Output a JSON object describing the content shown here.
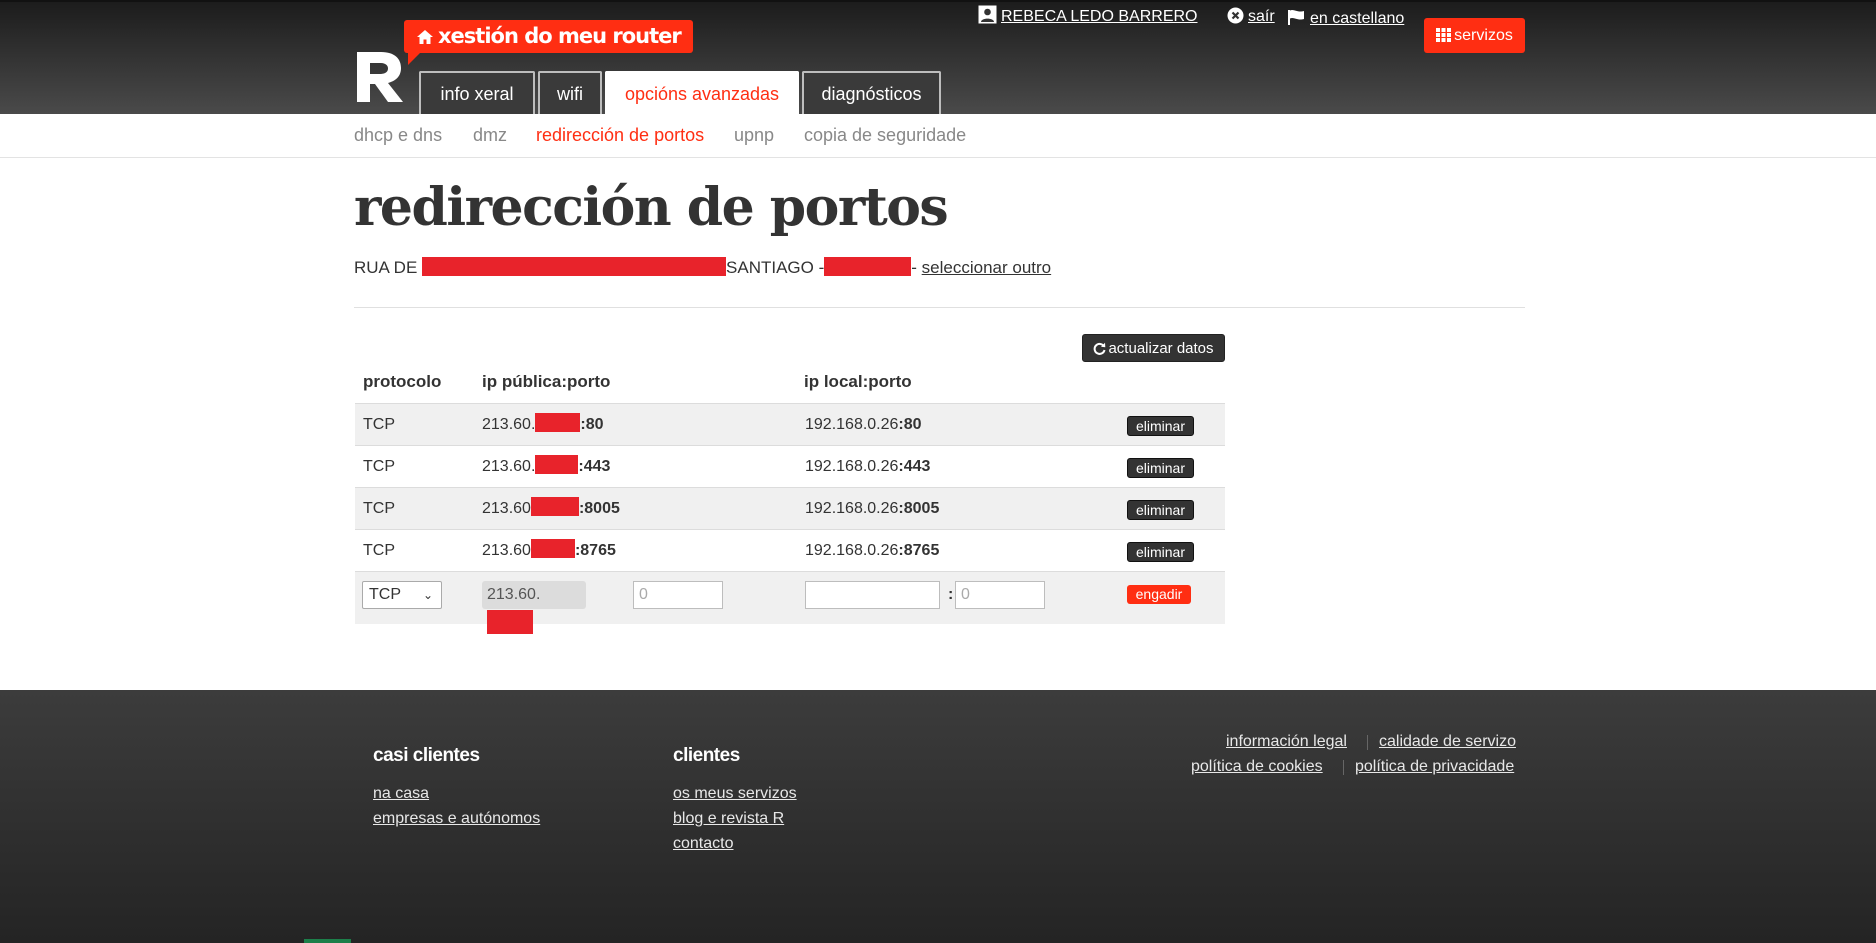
{
  "header": {
    "brand_badge": "xestión do meu router",
    "user_name": "REBECA LEDO BARRERO",
    "logout": "saír",
    "language": "en castellano",
    "services": "servizos",
    "tabs": [
      {
        "label": "info xeral"
      },
      {
        "label": "wifi"
      },
      {
        "label": "opcións avanzadas"
      },
      {
        "label": "diagnósticos"
      }
    ]
  },
  "subnav": [
    {
      "label": "dhcp e dns"
    },
    {
      "label": "dmz"
    },
    {
      "label": "redirección de portos"
    },
    {
      "label": "upnp"
    },
    {
      "label": "copia de seguridade"
    }
  ],
  "main": {
    "title": "redirección de portos",
    "address_prefix": "RUA DE",
    "address_city": "SANTIAGO -",
    "address_dash": "-",
    "select_other": "seleccionar outro",
    "refresh_button": "actualizar datos",
    "headers": {
      "protocol": "protocolo",
      "public": "ip pública:porto",
      "local": "ip local:porto"
    },
    "rules": [
      {
        "protocol": "TCP",
        "public_prefix": "213.60.",
        "public_port": ":80",
        "local_ip": "192.168.0.26",
        "local_port": ":80",
        "delete": "eliminar"
      },
      {
        "protocol": "TCP",
        "public_prefix": "213.60.",
        "public_port": ":443",
        "local_ip": "192.168.0.26",
        "local_port": ":443",
        "delete": "eliminar"
      },
      {
        "protocol": "TCP",
        "public_prefix": "213.60",
        "public_port": ":8005",
        "local_ip": "192.168.0.26",
        "local_port": ":8005",
        "delete": "eliminar"
      },
      {
        "protocol": "TCP",
        "public_prefix": "213.60",
        "public_port": ":8765",
        "local_ip": "192.168.0.26",
        "local_port": ":8765",
        "delete": "eliminar"
      }
    ],
    "new_rule": {
      "protocol": "TCP",
      "public_prefix": "213.60.",
      "public_port_placeholder": "0",
      "local_port_placeholder": "0",
      "separator": ":",
      "add": "engadir"
    }
  },
  "footer": {
    "col1_title": "casi clientes",
    "col1_links": [
      "na casa",
      "empresas e autónomos"
    ],
    "col2_title": "clientes",
    "col2_links": [
      "os meus servizos",
      "blog e revista R",
      "contacto"
    ],
    "legal_links": [
      "información legal",
      "calidade de servizo",
      "política de cookies",
      "política de privacidade"
    ]
  },
  "colors": {
    "accent": "#ff2e12",
    "redaction": "#e8232b",
    "dark": "#333333"
  }
}
